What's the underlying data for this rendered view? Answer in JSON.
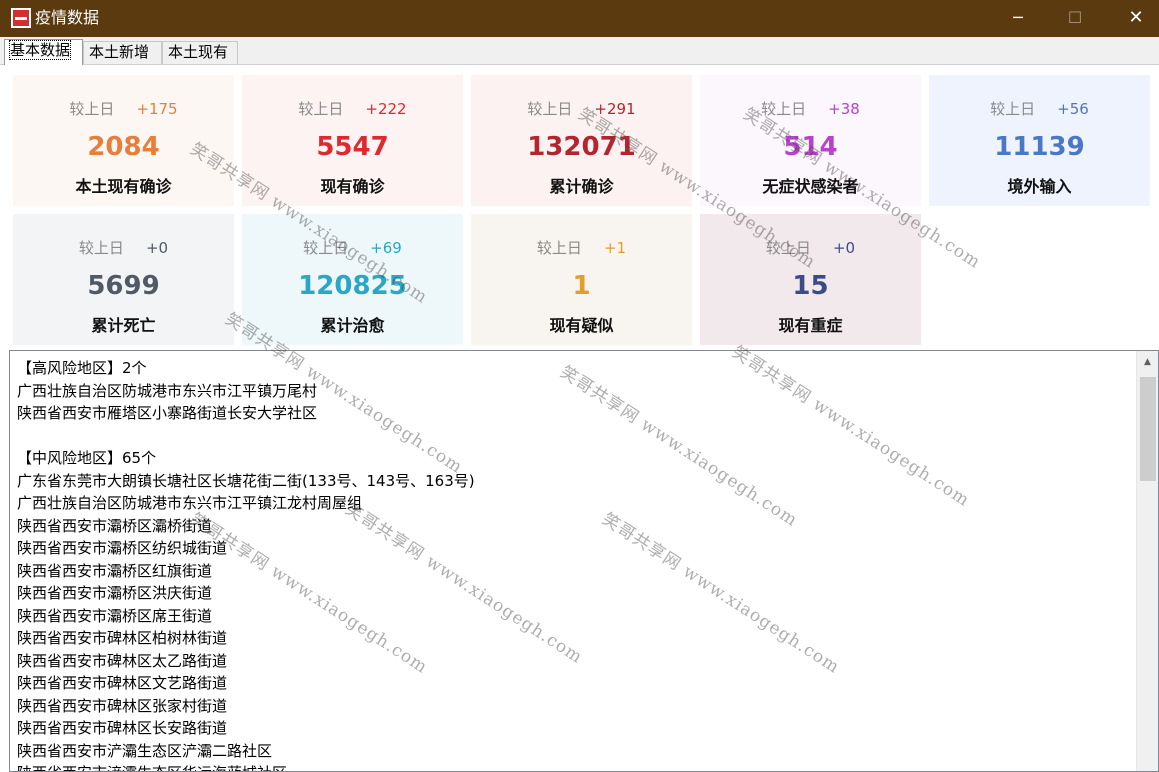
{
  "window": {
    "title": "疫情数据",
    "controls": {
      "minimize": "─",
      "maximize": "☐",
      "close": "✕"
    }
  },
  "tabs": [
    {
      "label": "基本数据",
      "active": true
    },
    {
      "label": "本土新增",
      "active": false
    },
    {
      "label": "本土现有",
      "active": false
    }
  ],
  "stats": [
    {
      "cmp_label": "较上日",
      "delta": "+175",
      "value": "2084",
      "label": "本土现有确诊",
      "color": "#e67e3c"
    },
    {
      "cmp_label": "较上日",
      "delta": "+222",
      "value": "5547",
      "label": "现有确诊",
      "color": "#e0282e"
    },
    {
      "cmp_label": "较上日",
      "delta": "+291",
      "value": "132071",
      "label": "累计确诊",
      "color": "#b3262e"
    },
    {
      "cmp_label": "较上日",
      "delta": "+38",
      "value": "514",
      "label": "无症状感染者",
      "color": "#b843c8"
    },
    {
      "cmp_label": "较上日",
      "delta": "+56",
      "value": "11139",
      "label": "境外输入",
      "color": "#4a78c8"
    },
    {
      "cmp_label": "较上日",
      "delta": "+0",
      "value": "5699",
      "label": "累计死亡",
      "color": "#4f5a66"
    },
    {
      "cmp_label": "较上日",
      "delta": "+69",
      "value": "120825",
      "label": "累计治愈",
      "color": "#2aa7c4"
    },
    {
      "cmp_label": "较上日",
      "delta": "+1",
      "value": "1",
      "label": "现有疑似",
      "color": "#e59b2e"
    },
    {
      "cmp_label": "较上日",
      "delta": "+0",
      "value": "15",
      "label": "现有重症",
      "color": "#3d4a8a"
    }
  ],
  "risk_text": [
    "【高风险地区】2个",
    "广西壮族自治区防城港市东兴市江平镇万尾村",
    "陕西省西安市雁塔区小寨路街道长安大学社区",
    "",
    "【中风险地区】65个",
    "广东省东莞市大朗镇长塘社区长塘花街二街(133号、143号、163号)",
    "广西壮族自治区防城港市东兴市江平镇江龙村周屋组",
    "陕西省西安市灞桥区灞桥街道",
    "陕西省西安市灞桥区纺织城街道",
    "陕西省西安市灞桥区红旗街道",
    "陕西省西安市灞桥区洪庆街道",
    "陕西省西安市灞桥区席王街道",
    "陕西省西安市碑林区柏树林街道",
    "陕西省西安市碑林区太乙路街道",
    "陕西省西安市碑林区文艺路街道",
    "陕西省西安市碑林区张家村街道",
    "陕西省西安市碑林区长安路街道",
    "陕西省西安市浐灞生态区浐灞二路社区",
    "陕西省西安市浐灞生态区华远海蓝城社区"
  ],
  "watermark": "笑哥共享网 www.xiaogegh.com"
}
